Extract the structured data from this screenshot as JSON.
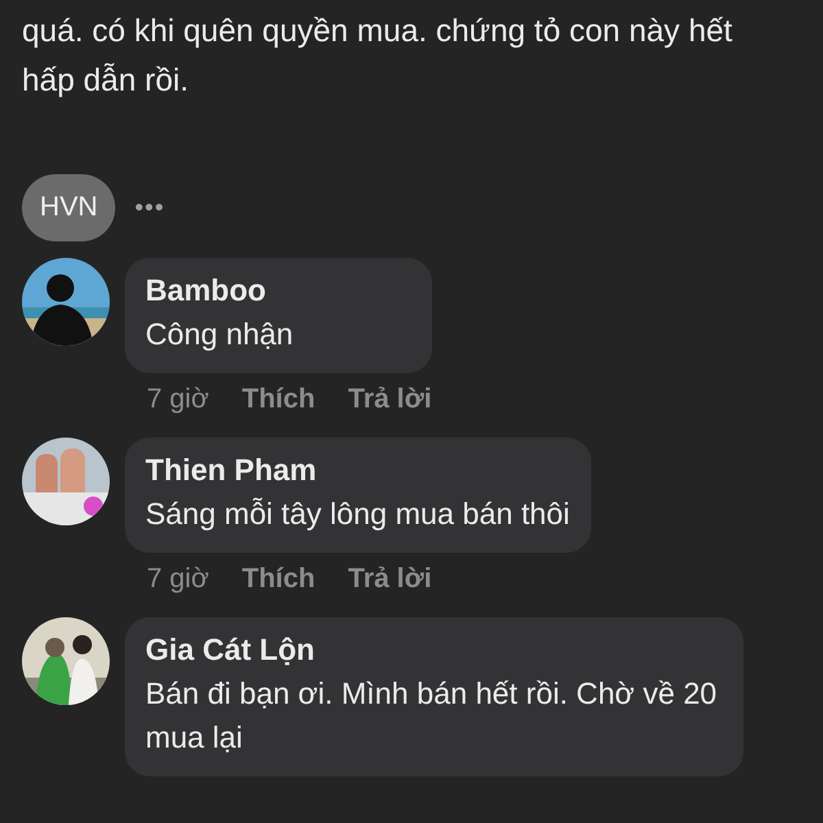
{
  "post_text": "quá. có khi quên quyền mua. chứng tỏ con này hết hấp dẫn rồi.",
  "author_chip": {
    "label": "HVN",
    "more": "•••"
  },
  "comments": [
    {
      "name": "Bamboo",
      "text": "Công nhận",
      "time": "7 giờ",
      "like": "Thích",
      "reply": "Trả lời"
    },
    {
      "name": "Thien Pham",
      "text": "Sáng mỗi tây lông mua bán thôi",
      "time": "7 giờ",
      "like": "Thích",
      "reply": "Trả lời"
    },
    {
      "name": "Gia Cát Lộn",
      "text": "Bán đi bạn ơi. Mình bán hết rồi. Chờ về 20 mua lại"
    }
  ]
}
